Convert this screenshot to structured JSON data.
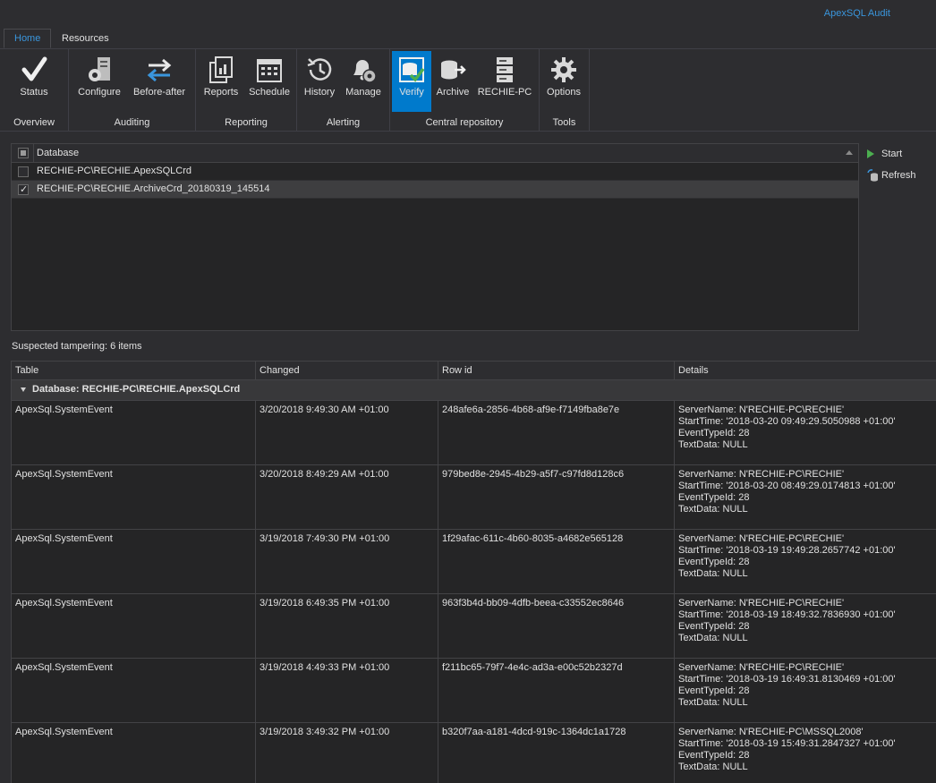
{
  "app": {
    "title": "ApexSQL Audit"
  },
  "tabs": [
    {
      "label": "Home",
      "active": true
    },
    {
      "label": "Resources",
      "active": false
    }
  ],
  "ribbon": {
    "groups": [
      {
        "label": "Overview",
        "buttons": [
          {
            "label": "Status",
            "icon": "checkmark-icon"
          }
        ]
      },
      {
        "label": "Auditing",
        "buttons": [
          {
            "label": "Configure",
            "icon": "server-gear-icon"
          },
          {
            "label": "Before-after",
            "icon": "swap-arrows-icon"
          }
        ]
      },
      {
        "label": "Reporting",
        "buttons": [
          {
            "label": "Reports",
            "icon": "reports-icon"
          },
          {
            "label": "Schedule",
            "icon": "calendar-icon"
          }
        ]
      },
      {
        "label": "Alerting",
        "buttons": [
          {
            "label": "History",
            "icon": "history-icon"
          },
          {
            "label": "Manage",
            "icon": "bell-gear-icon"
          }
        ]
      },
      {
        "label": "Central repository",
        "buttons": [
          {
            "label": "Verify",
            "icon": "verify-icon",
            "selected": true
          },
          {
            "label": "Archive",
            "icon": "archive-icon"
          },
          {
            "label": "RECHIE-PC",
            "icon": "server-icon"
          }
        ]
      },
      {
        "label": "Tools",
        "buttons": [
          {
            "label": "Options",
            "icon": "gear-icon"
          }
        ]
      }
    ]
  },
  "databases": {
    "header": "Database",
    "rows": [
      {
        "name": "RECHIE-PC\\RECHIE.ApexSQLCrd",
        "checked": false
      },
      {
        "name": "RECHIE-PC\\RECHIE.ArchiveCrd_20180319_145514",
        "checked": true
      }
    ]
  },
  "actions": {
    "start": "Start",
    "refresh": "Refresh"
  },
  "status": "Suspected tampering: 6 items",
  "grid": {
    "columns": [
      "Table",
      "Changed",
      "Row id",
      "Details"
    ],
    "group": "Database: RECHIE-PC\\RECHIE.ApexSQLCrd",
    "rows": [
      {
        "table": "ApexSql.SystemEvent",
        "changed": "3/20/2018 9:49:30 AM +01:00",
        "row_id": "248afe6a-2856-4b68-af9e-f7149fba8e7e",
        "details": [
          "ServerName: N'RECHIE-PC\\RECHIE'",
          "StartTime: '2018-03-20 09:49:29.5050988 +01:00'",
          "EventTypeId: 28",
          "TextData: NULL"
        ]
      },
      {
        "table": "ApexSql.SystemEvent",
        "changed": "3/20/2018 8:49:29 AM +01:00",
        "row_id": "979bed8e-2945-4b29-a5f7-c97fd8d128c6",
        "details": [
          "ServerName: N'RECHIE-PC\\RECHIE'",
          "StartTime: '2018-03-20 08:49:29.0174813 +01:00'",
          "EventTypeId: 28",
          "TextData: NULL"
        ]
      },
      {
        "table": "ApexSql.SystemEvent",
        "changed": "3/19/2018 7:49:30 PM +01:00",
        "row_id": "1f29afac-611c-4b60-8035-a4682e565128",
        "details": [
          "ServerName: N'RECHIE-PC\\RECHIE'",
          "StartTime: '2018-03-19 19:49:28.2657742 +01:00'",
          "EventTypeId: 28",
          "TextData: NULL"
        ]
      },
      {
        "table": "ApexSql.SystemEvent",
        "changed": "3/19/2018 6:49:35 PM +01:00",
        "row_id": "963f3b4d-bb09-4dfb-beea-c33552ec8646",
        "details": [
          "ServerName: N'RECHIE-PC\\RECHIE'",
          "StartTime: '2018-03-19 18:49:32.7836930 +01:00'",
          "EventTypeId: 28",
          "TextData: NULL"
        ]
      },
      {
        "table": "ApexSql.SystemEvent",
        "changed": "3/19/2018 4:49:33 PM +01:00",
        "row_id": "f211bc65-79f7-4e4c-ad3a-e00c52b2327d",
        "details": [
          "ServerName: N'RECHIE-PC\\RECHIE'",
          "StartTime: '2018-03-19 16:49:31.8130469 +01:00'",
          "EventTypeId: 28",
          "TextData: NULL"
        ]
      },
      {
        "table": "ApexSql.SystemEvent",
        "changed": "3/19/2018 3:49:32 PM +01:00",
        "row_id": "b320f7aa-a181-4dcd-919c-1364dc1a1728",
        "details": [
          "ServerName: N'RECHIE-PC\\MSSQL2008'",
          "StartTime: '2018-03-19 15:49:31.2847327 +01:00'",
          "EventTypeId: 28",
          "TextData: NULL"
        ]
      }
    ]
  }
}
